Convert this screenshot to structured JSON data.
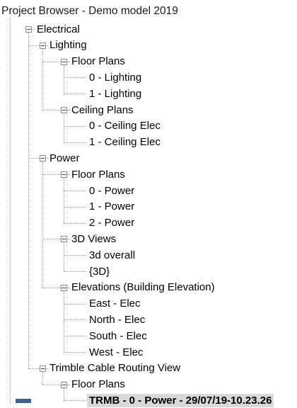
{
  "window": {
    "title": "Project Browser - Demo model 2019"
  },
  "tree": [
    {
      "label": "Electrical",
      "level": 1,
      "expanded": true,
      "name": "tree-node-electrical"
    },
    {
      "label": "Lighting",
      "level": 2,
      "expanded": true,
      "name": "tree-node-lighting"
    },
    {
      "label": "Floor Plans",
      "level": 3,
      "expanded": true,
      "name": "tree-node-lighting-floor-plans"
    },
    {
      "label": "0 - Lighting",
      "level": 4,
      "name": "tree-node-0-lighting"
    },
    {
      "label": "1 - Lighting",
      "level": 4,
      "name": "tree-node-1-lighting"
    },
    {
      "label": "Ceiling Plans",
      "level": 3,
      "expanded": true,
      "name": "tree-node-ceiling-plans"
    },
    {
      "label": "0 - Ceiling Elec",
      "level": 4,
      "name": "tree-node-0-ceiling-elec"
    },
    {
      "label": "1 - Ceiling Elec",
      "level": 4,
      "name": "tree-node-1-ceiling-elec"
    },
    {
      "label": "Power",
      "level": 2,
      "expanded": true,
      "name": "tree-node-power"
    },
    {
      "label": "Floor Plans",
      "level": 3,
      "expanded": true,
      "name": "tree-node-power-floor-plans"
    },
    {
      "label": "0 - Power",
      "level": 4,
      "name": "tree-node-0-power"
    },
    {
      "label": "1 - Power",
      "level": 4,
      "name": "tree-node-1-power"
    },
    {
      "label": "2 - Power",
      "level": 4,
      "name": "tree-node-2-power"
    },
    {
      "label": "3D Views",
      "level": 3,
      "expanded": true,
      "name": "tree-node-3d-views"
    },
    {
      "label": "3d overall",
      "level": 4,
      "name": "tree-node-3d-overall"
    },
    {
      "label": "{3D}",
      "level": 4,
      "name": "tree-node-3d-default"
    },
    {
      "label": "Elevations (Building Elevation)",
      "level": 3,
      "expanded": true,
      "name": "tree-node-elevations"
    },
    {
      "label": "East - Elec",
      "level": 4,
      "name": "tree-node-east-elec"
    },
    {
      "label": "North - Elec",
      "level": 4,
      "name": "tree-node-north-elec"
    },
    {
      "label": "South - Elec",
      "level": 4,
      "name": "tree-node-south-elec"
    },
    {
      "label": "West - Elec",
      "level": 4,
      "name": "tree-node-west-elec"
    },
    {
      "label": "Trimble Cable Routing View",
      "level": 2,
      "expanded": true,
      "name": "tree-node-trimble-cable-routing-view"
    },
    {
      "label": "Floor Plans",
      "level": 3,
      "expanded": true,
      "name": "tree-node-trimble-floor-plans"
    },
    {
      "label": "TRMB - 0 - Power - 29/07/19-10.23.26",
      "level": 4,
      "selected": true,
      "name": "tree-node-trmb-0-power"
    }
  ],
  "colors": {
    "selection": "#d9d9d9",
    "connector": "#9a9a9a"
  }
}
